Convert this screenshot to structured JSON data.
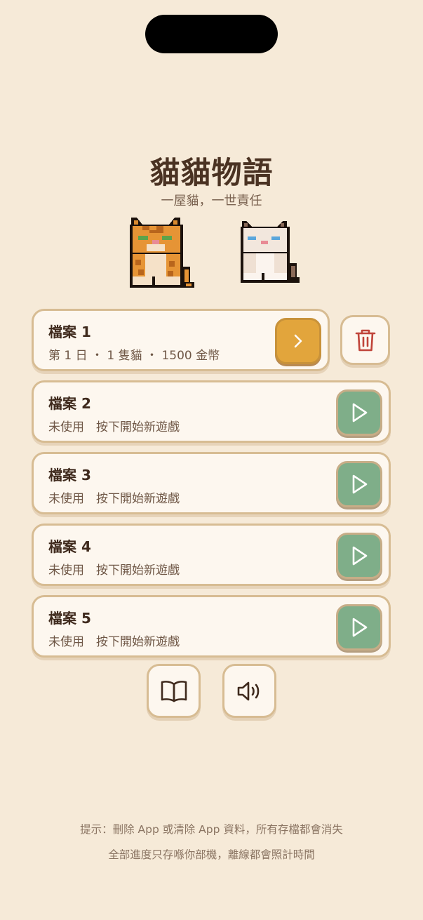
{
  "app": {
    "title": "貓貓物語",
    "subtitle": "一屋貓，一世責任"
  },
  "slots": [
    {
      "title": "檔案 1",
      "meta": "第 1 日 ・ 1 隻貓 ・ 1500 金幣",
      "state": "saved",
      "action_icon": "chevron-right-icon"
    },
    {
      "title": "檔案 2",
      "meta": "未使用　按下開始新遊戲",
      "state": "empty",
      "action_icon": "play-icon"
    },
    {
      "title": "檔案 3",
      "meta": "未使用　按下開始新遊戲",
      "state": "empty",
      "action_icon": "play-icon"
    },
    {
      "title": "檔案 4",
      "meta": "未使用　按下開始新遊戲",
      "state": "empty",
      "action_icon": "play-icon"
    },
    {
      "title": "檔案 5",
      "meta": "未使用　按下開始新遊戲",
      "state": "empty",
      "action_icon": "play-icon"
    }
  ],
  "toolbar": {
    "delete_icon": "trash-icon",
    "guide_icon": "book-icon",
    "sound_icon": "speaker-icon"
  },
  "hints": {
    "line1": "提示：刪除 App 或清除 App 資料，所有存檔都會消失",
    "line2": "全部進度只存喺你部機，離線都會照計時間"
  },
  "colors": {
    "background": "#f6ead8",
    "card": "#fdf7ef",
    "card_border": "#d7bc93",
    "continue_button": "#e2a53c",
    "play_button": "#7fae89",
    "delete_icon": "#c0443a",
    "title_text": "#4a3222"
  }
}
